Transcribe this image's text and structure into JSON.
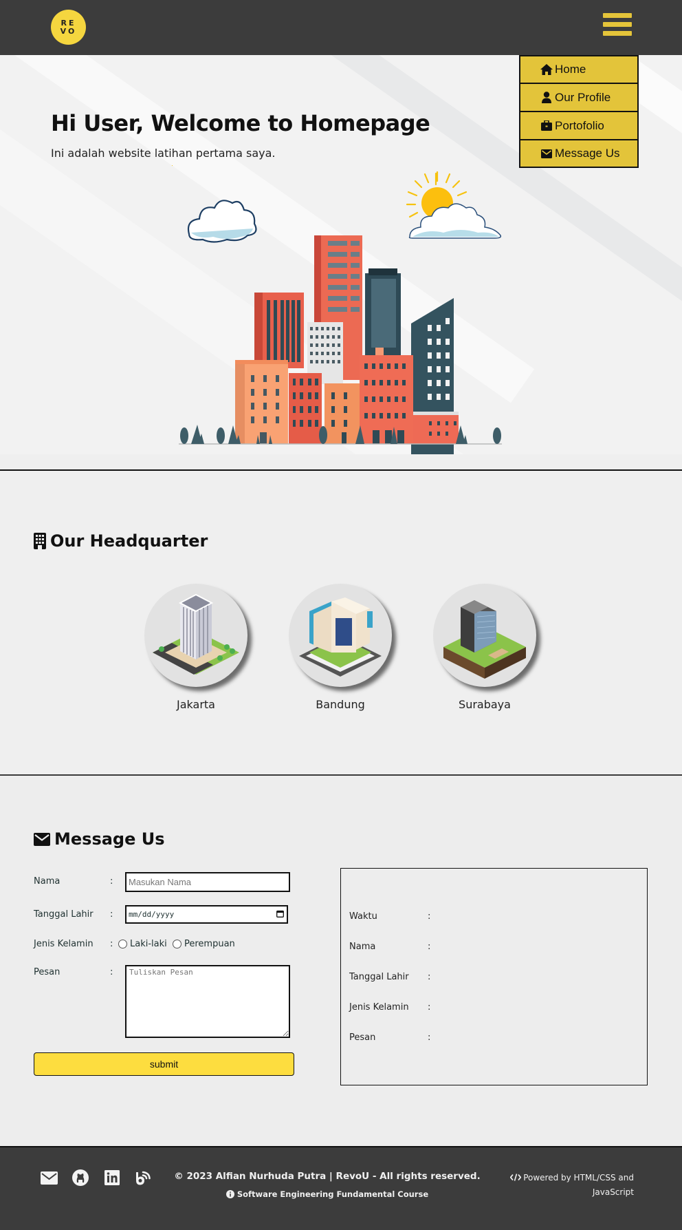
{
  "header": {
    "logo_letters": [
      "R",
      "E",
      "V",
      "O"
    ],
    "logo_alt": "RevoU logo",
    "accent_color": "#e3c43a",
    "bg_color": "#3c3c3c"
  },
  "menu": {
    "items": [
      {
        "label": "Home",
        "icon": "home-icon"
      },
      {
        "label": "Our Profile",
        "icon": "user-icon"
      },
      {
        "label": "Portofolio",
        "icon": "briefcase-icon"
      },
      {
        "label": "Message Us",
        "icon": "envelope-icon"
      }
    ]
  },
  "hero": {
    "title": "Hi User, Welcome to Homepage",
    "subtitle": "Ini adalah website latihan pertama saya."
  },
  "headquarter": {
    "title": "Our Headquarter",
    "icon": "building-icon",
    "cities": [
      {
        "name": "Jakarta"
      },
      {
        "name": "Bandung"
      },
      {
        "name": "Surabaya"
      }
    ]
  },
  "message": {
    "title": "Message Us",
    "icon": "envelope-icon",
    "form": {
      "nama_label": "Nama",
      "nama_placeholder": "Masukan Nama",
      "nama_value": "",
      "tanggal_label": "Tanggal Lahir",
      "tanggal_placeholder": "mm/dd/yyyy",
      "gender_label": "Jenis Kelamin",
      "gender_options": [
        "Laki-laki",
        "Perempuan"
      ],
      "pesan_label": "Pesan",
      "pesan_placeholder": "Tuliskan Pesan",
      "colon": ":",
      "submit_label": "submit"
    },
    "result": {
      "rows": [
        {
          "label": "Waktu",
          "value": ""
        },
        {
          "label": "Nama",
          "value": ""
        },
        {
          "label": "Tanggal Lahir",
          "value": ""
        },
        {
          "label": "Jenis Kelamin",
          "value": ""
        },
        {
          "label": "Pesan",
          "value": ""
        }
      ]
    }
  },
  "footer": {
    "social": [
      "envelope-icon",
      "github-icon",
      "linkedin-icon",
      "blogger-icon"
    ],
    "copyright": "© 2023 Alfian Nurhuda Putra | RevoU - All rights reserved.",
    "course": "Software Engineering Fundamental Course",
    "powered": "Powered by HTML/CSS and JavaScript"
  }
}
